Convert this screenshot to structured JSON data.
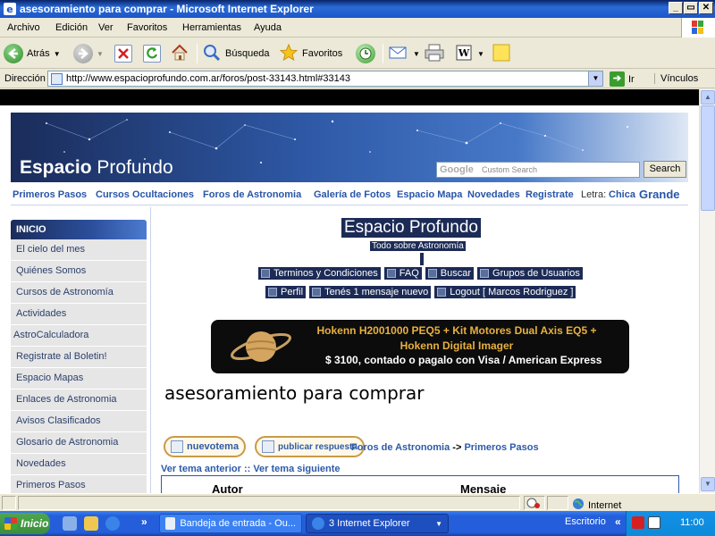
{
  "window": {
    "title": "asesoramiento para comprar - Microsoft Internet Explorer",
    "controls": [
      "_",
      "▭",
      "✕"
    ]
  },
  "menubar": {
    "items": [
      "Archivo",
      "Edición",
      "Ver",
      "Favoritos",
      "Herramientas",
      "Ayuda"
    ]
  },
  "toolbar": {
    "back_label": "Atrás",
    "search_label": "Búsqueda",
    "favorites_label": "Favoritos"
  },
  "addressbar": {
    "label": "Dirección",
    "url": "http://www.espacioprofundo.com.ar/foros/post-33143.html#33143",
    "go_label": "Ir",
    "links_label": "Vínculos"
  },
  "site": {
    "logo_bold": "Espacio",
    "logo_light": "Profundo",
    "search_logo": "Google",
    "search_placeholder": "Custom Search",
    "search_button": "Search",
    "nav": [
      "Primeros Pasos",
      "Cursos Ocultaciones",
      "Foros de Astronomia",
      "Galería de Fotos",
      "Espacio Mapa",
      "Novedades",
      "Registrate"
    ],
    "font_label": "Letra:",
    "font_small": "Chica",
    "font_large": "Grande"
  },
  "leftmenu": {
    "header": "INICIO",
    "items": [
      "El cielo del mes",
      "Quiénes Somos",
      "Cursos de Astronomía",
      "Actividades",
      "AstroCalculadora",
      "Registrate al Boletin!",
      "Espacio Mapas",
      "Enlaces de Astronomia",
      "Avisos Clasificados",
      "Glosario de Astronomia",
      "Novedades",
      "Primeros Pasos"
    ]
  },
  "forum": {
    "title": "Espacio Profundo",
    "tagline": "Todo sobre Astronomía",
    "links_row1": [
      "Terminos y Condiciones",
      "FAQ",
      "Buscar",
      "Grupos de Usuarios"
    ],
    "links_row2": [
      "Perfil",
      "Tenés 1 mensaje nuevo",
      "Logout [ Marcos Rodriguez ]"
    ]
  },
  "banner": {
    "line1": "Hokenn H2001000 PEQ5 + Kit Motores Dual Axis EQ5 + Hokenn Digital Imager",
    "line2": "$ 3100, contado  o pagalo con Visa / American Express"
  },
  "topic": {
    "title": "asesoramiento para comprar",
    "new_topic_btn": "nuevotema",
    "reply_btn": "publicar respuesta",
    "breadcrumb_forum": "Foros de Astronomia",
    "breadcrumb_sep": "->",
    "breadcrumb_section": "Primeros Pasos",
    "prev": "Ver tema anterior",
    "sep": "::",
    "next": "Ver tema siguiente",
    "col_author": "Autor",
    "col_message": "Mensaje"
  },
  "statusbar": {
    "zone": "Internet"
  },
  "taskbar": {
    "start": "Inicio",
    "tasks": [
      "Bandeja de entrada - Ou...",
      "3 Internet Explorer"
    ],
    "deskbar": "Escritorio",
    "clock": "11:00"
  }
}
